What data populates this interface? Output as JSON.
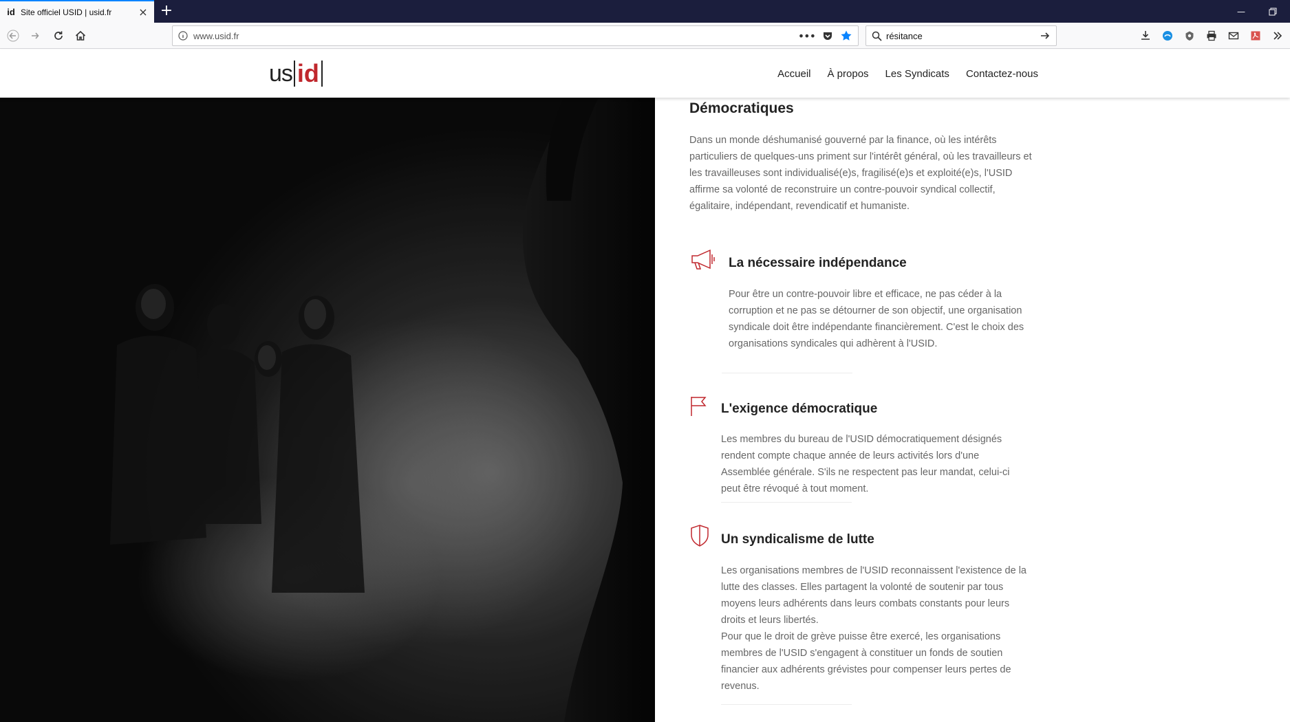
{
  "browser": {
    "tab": {
      "favicon": "id",
      "title": "Site officiel USID | usid.fr",
      "close_icon": "close-icon"
    },
    "new_tab_icon": "plus-icon",
    "url": "www.usid.fr",
    "search_query": "résitance",
    "accent_color": "#0a84ff"
  },
  "site": {
    "logo": {
      "left": "us",
      "right": "id"
    },
    "nav": [
      "Accueil",
      "À propos",
      "Les Syndicats",
      "Contactez-nous"
    ],
    "brand_color": "#c0272d"
  },
  "content": {
    "intro_title": "Démocratiques",
    "intro_text": "Dans un monde déshumanisé gouverné par la finance, où les intérêts particuliers de quelques-uns priment sur l'intérêt général, où les travailleurs et les travailleuses sont individualisé(e)s, fragilisé(e)s et exploité(e)s, l'USID affirme sa volonté de reconstruire un contre-pouvoir syndical collectif, égalitaire, indépendant, revendicatif et humaniste.",
    "features": [
      {
        "icon": "megaphone-icon",
        "title": "La nécessaire indépendance",
        "text": "Pour être un contre-pouvoir libre et efficace, ne pas céder à la corruption et ne pas se détourner de son objectif, une organisation syndicale doit être indépendante financièrement. C'est le choix des organisations syndicales qui adhèrent à l'USID."
      },
      {
        "icon": "flag-icon",
        "title": "L'exigence démocratique",
        "text": "Les membres du bureau de l'USID démocratiquement désignés rendent compte chaque année de leurs activités lors d'une Assemblée générale. S'ils ne respectent pas leur mandat, celui-ci peut être révoqué à tout moment."
      },
      {
        "icon": "shield-icon",
        "title": "Un syndicalisme de lutte",
        "text": "Les organisations membres de l'USID reconnaissent l'existence de la lutte des classes. Elles partagent la volonté de soutenir par tous moyens leurs adhérents dans leurs combats constants pour leurs droits et leurs libertés.",
        "text2": "Pour que le droit de grève puisse être exercé, les organisations membres de l'USID s'engagent à constituer un fonds de soutien financier aux adhérents grévistes pour compenser leurs pertes de revenus."
      }
    ]
  }
}
